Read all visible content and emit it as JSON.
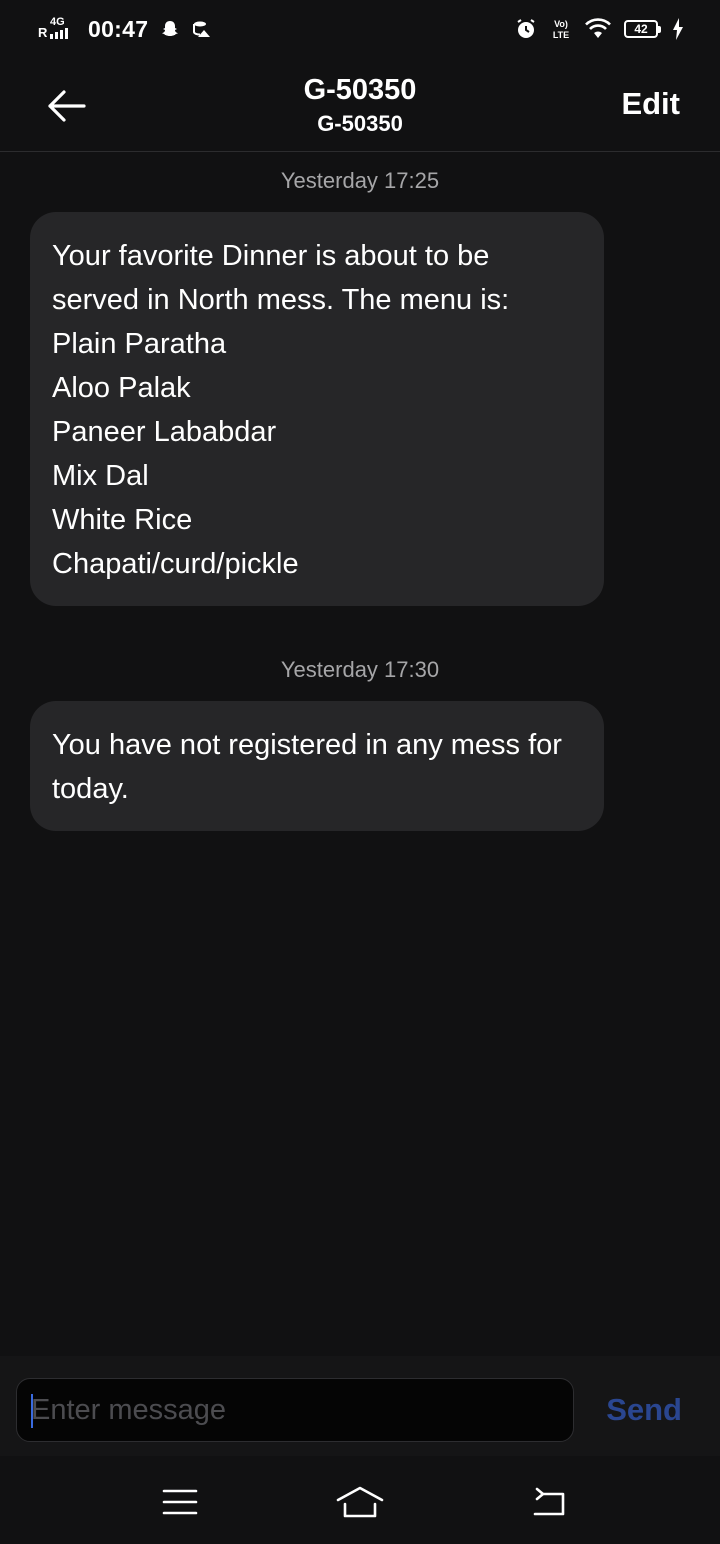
{
  "status_bar": {
    "roaming": "R",
    "network": "4G",
    "time": "00:47",
    "battery": "42",
    "icons": [
      "snapchat-icon",
      "storage-icon",
      "alarm-icon",
      "volte-icon",
      "wifi-icon",
      "charging-icon"
    ],
    "volte_label": "Vo) LTE"
  },
  "header": {
    "title": "G-50350",
    "subtitle": "G-50350",
    "edit_label": "Edit",
    "back_icon": "back-arrow-icon"
  },
  "messages": [
    {
      "timestamp": "Yesterday 17:25",
      "text": "Your favorite Dinner is about to be served in North mess. The menu is:\nPlain Paratha\nAloo Palak\nPaneer Lababdar\nMix Dal\nWhite Rice\nChapati/curd/pickle"
    },
    {
      "timestamp": "Yesterday 17:30",
      "text": "You have not registered in any mess for today."
    }
  ],
  "composer": {
    "placeholder": "Enter message",
    "value": "",
    "send_label": "Send"
  },
  "nav_bar": {
    "icons": [
      "menu-icon",
      "home-icon",
      "back-icon"
    ]
  },
  "colors": {
    "background": "#111112",
    "bubble": "#262628",
    "timestamp": "#a6a6a8",
    "send": "#2a4690",
    "caret": "#3a6be0"
  }
}
